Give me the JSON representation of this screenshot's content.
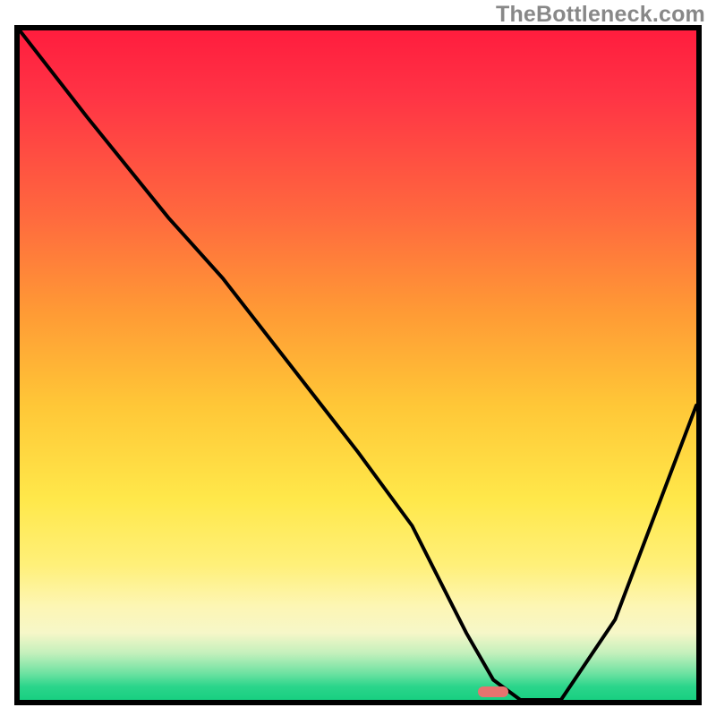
{
  "watermark": "TheBottleneck.com",
  "colors": {
    "frame_border": "#000000",
    "curve_stroke": "#000000",
    "marker": "#e7736f",
    "gradient_top": "#ff1d3e",
    "gradient_bottom": "#18cf81"
  },
  "chart_data": {
    "type": "line",
    "title": "",
    "xlabel": "",
    "ylabel": "",
    "xlim": [
      0,
      100
    ],
    "ylim": [
      0,
      100
    ],
    "grid": false,
    "legend": "none",
    "series": [
      {
        "name": "bottleneck-curve",
        "x": [
          0,
          10,
          22,
          30,
          40,
          50,
          58,
          62,
          66,
          70,
          74,
          80,
          88,
          100
        ],
        "y": [
          100,
          87,
          72,
          63,
          50,
          37,
          26,
          18,
          10,
          3,
          0,
          0,
          12,
          44
        ]
      }
    ],
    "annotations": [
      {
        "name": "valley-marker",
        "x": 70,
        "y": 1
      }
    ]
  }
}
